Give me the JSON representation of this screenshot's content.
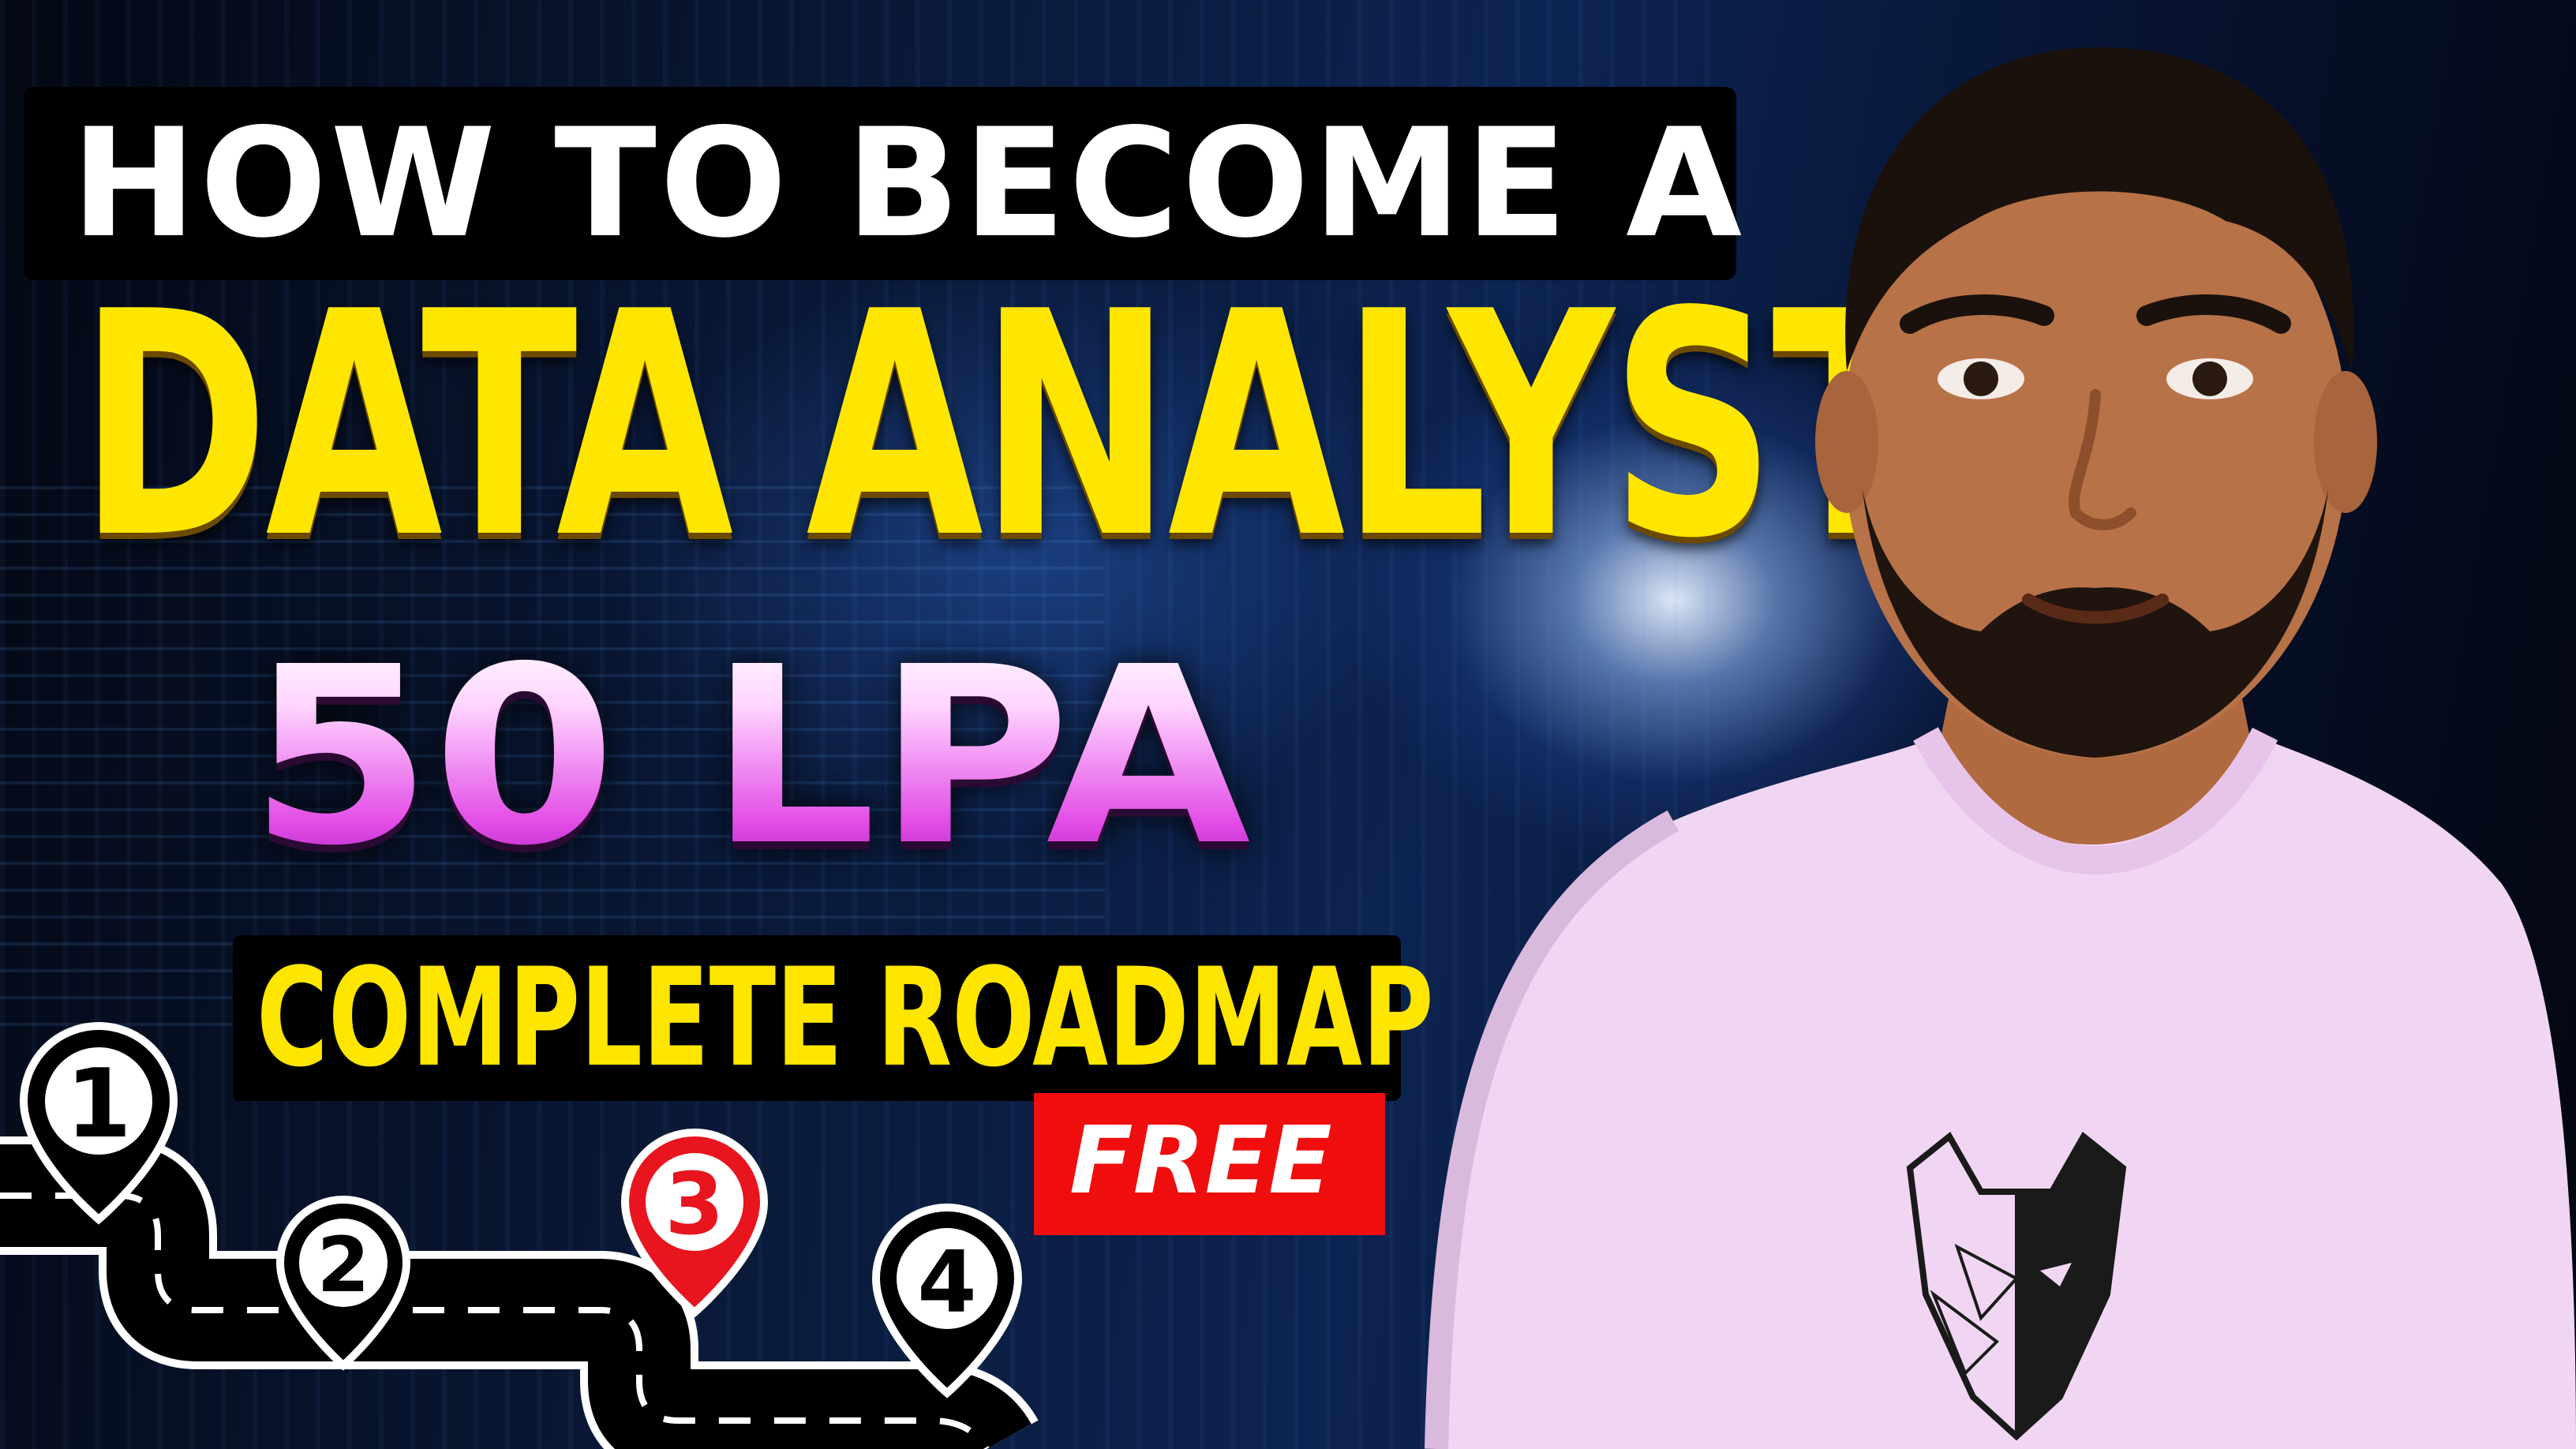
{
  "thumbnail": {
    "headline_line1": "HOW TO BECOME A",
    "headline_line2": "DATA ANALYST",
    "headline_line3": "50 LPA",
    "subtitle": "COMPLETE ROADMAP",
    "badge": "FREE",
    "road_markers": [
      "1",
      "2",
      "3",
      "4"
    ]
  },
  "colors": {
    "headline_yellow": "#ffe600",
    "headline_pink": "#e24ae6",
    "badge_red": "#f00d0d",
    "marker_active": "#e8141e",
    "shirt": "#f1d6f3"
  },
  "icons": [
    "map-pin-icon",
    "road-icon",
    "wolf-logo-icon"
  ]
}
